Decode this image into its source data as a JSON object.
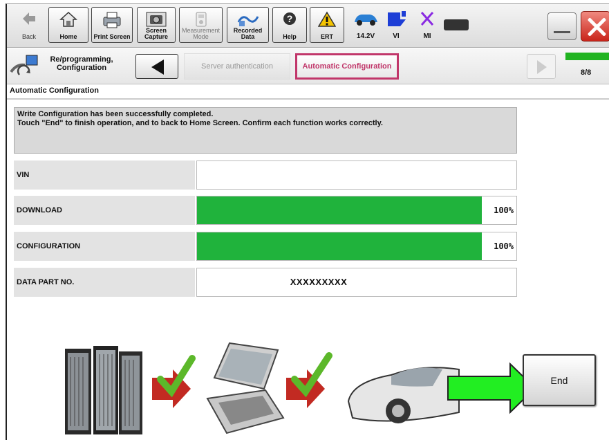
{
  "toolbar": {
    "back_label": "Back",
    "home_label": "Home",
    "print_label": "Print Screen",
    "capture_label": "Screen Capture",
    "measurement_label": "Measurement Mode",
    "recorded_label": "Recorded Data",
    "help_label": "Help",
    "ert_label": "ERT",
    "voltage_label": "14.2V",
    "vi_label": "VI",
    "mi_label": "MI"
  },
  "breadcrumb": {
    "title": "Re/programming, Configuration",
    "step_prev": "Server authentication",
    "step_current": "Automatic Configuration",
    "step_count": "8/8"
  },
  "section_title": "Automatic Configuration",
  "message": {
    "line1": "Write Configuration has been successfully completed.",
    "line2": "Touch \"End\" to finish operation, and to back to Home Screen. Confirm each function works correctly."
  },
  "rows": {
    "vin": {
      "label": "VIN",
      "value": ""
    },
    "download": {
      "label": "DOWNLOAD",
      "percent_text": "100%",
      "progress": 1.0
    },
    "configuration": {
      "label": "CONFIGURATION",
      "percent_text": "100%",
      "progress": 1.0
    },
    "data_part_no": {
      "label": "DATA PART NO.",
      "value": "XXXXXXXXX"
    }
  },
  "end_label": "End",
  "colors": {
    "progress": "#20b33c",
    "active_step": "#c1366a",
    "close": "#c9241a",
    "arrow": "#22ee22"
  },
  "icons": [
    "back-icon",
    "home-icon",
    "printer-icon",
    "camera-icon",
    "measurement-icon",
    "recorded-data-icon",
    "help-icon",
    "warning-icon",
    "car-battery-icon",
    "vi-icon",
    "mi-icon",
    "server-icon",
    "laptop-icon",
    "car-icon",
    "checkmark-icon",
    "arrow-right-icon"
  ]
}
